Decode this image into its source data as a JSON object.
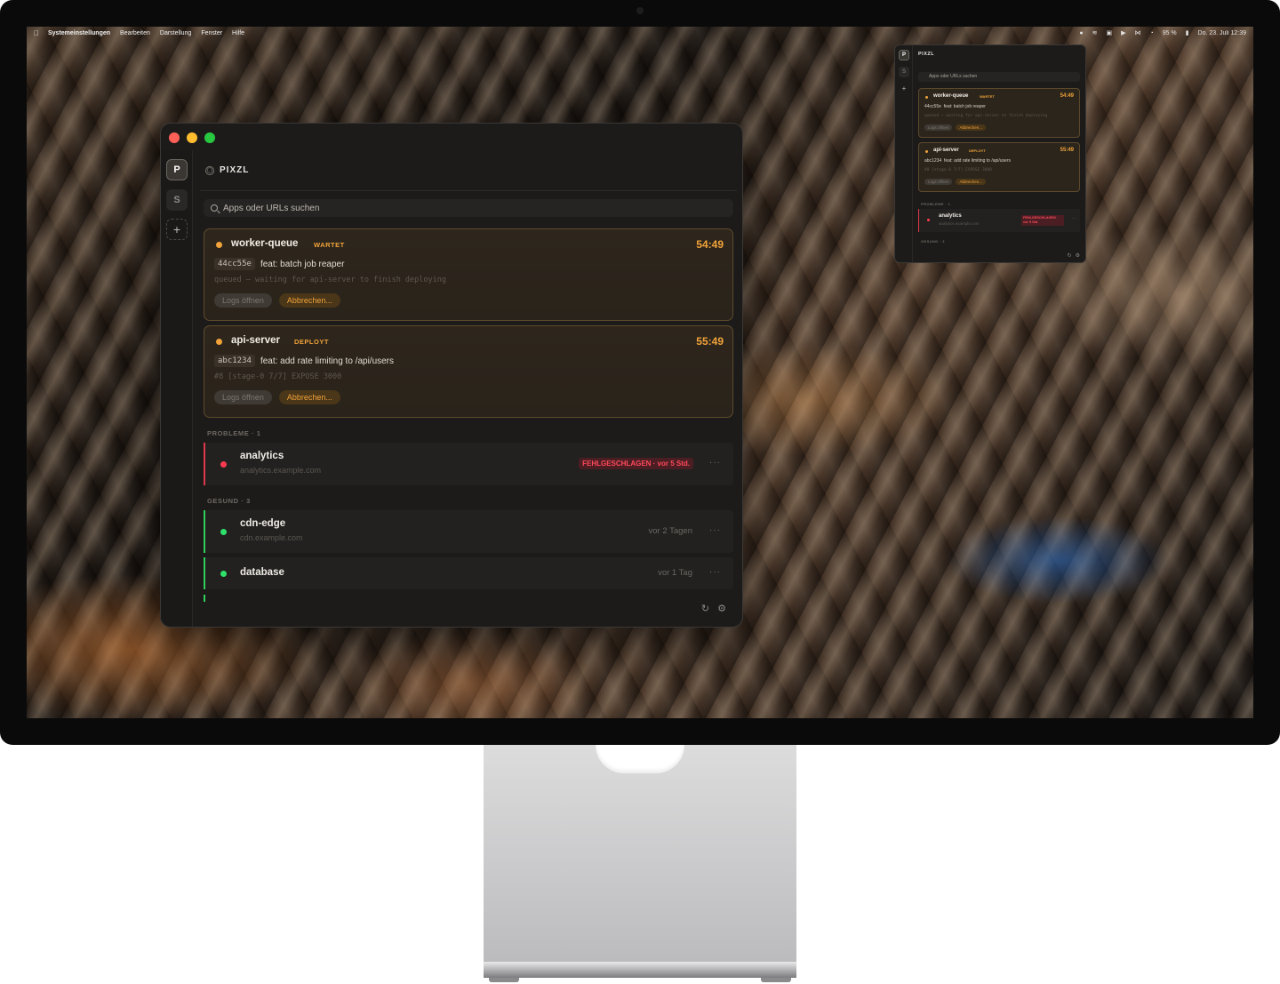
{
  "menubar": {
    "apple_icon": "apple-logo",
    "items": [
      "Systemeinstellungen",
      "Bearbeiten",
      "Darstellung",
      "Fenster",
      "Hilfe"
    ],
    "status_icons": [
      "control-center-icon",
      "audio-icon",
      "display-icon",
      "play-icon",
      "bluetooth-icon",
      "wifi-icon"
    ],
    "battery": "95 %",
    "datetime": "Do. 23. Juli  12:39"
  },
  "app": {
    "brand": "PIXZL",
    "rail": {
      "primary": "P",
      "secondary": "S",
      "add": "+"
    },
    "search": {
      "placeholder": "Apps oder URLs suchen"
    },
    "deployments": [
      {
        "name": "worker-queue",
        "status": "WARTET",
        "timer": "54:49",
        "sha": "44cc55e",
        "message": "feat: batch job reaper",
        "log": "queued — waiting for api-server to finish deploying",
        "logs_label": "Logs öffnen",
        "cancel_label": "Abbrechen..."
      },
      {
        "name": "api-server",
        "status": "DEPLOYT",
        "timer": "55:49",
        "sha": "abc1234",
        "message": "feat: add rate limiting to /api/users",
        "log": "#8 [stage-0 7/7] EXPOSE 3000",
        "logs_label": "Logs öffnen",
        "cancel_label": "Abbrechen..."
      }
    ],
    "problems_header": "PROBLEME · 1",
    "problems": [
      {
        "name": "analytics",
        "url": "analytics.example.com",
        "status": "FEHLGESCHLAGEN · vor 5 Std.",
        "more": "···"
      }
    ],
    "healthy_header": "GESUND · 3",
    "healthy": [
      {
        "name": "cdn-edge",
        "url": "cdn.example.com",
        "time": "vor 2 Tagen",
        "more": "···"
      },
      {
        "name": "database",
        "url": "",
        "time": "vor 1 Tag",
        "more": "···"
      }
    ],
    "footer": {
      "refresh_icon": "refresh-icon",
      "settings_icon": "gear-icon"
    }
  },
  "mini": {
    "brand": "PIXZL",
    "search_placeholder": "Apps oder URLs suchen",
    "problems_header": "PROBLEME · 1",
    "healthy_header": "GESUND · 3",
    "fail_label": "FEHLGESCHLAGEN · vor 5 Std."
  },
  "colors": {
    "accent_orange": "#f2a33a",
    "error_red": "#ff3b4f",
    "ok_green": "#2fe06a",
    "window_bg": "#1c1b1a"
  }
}
